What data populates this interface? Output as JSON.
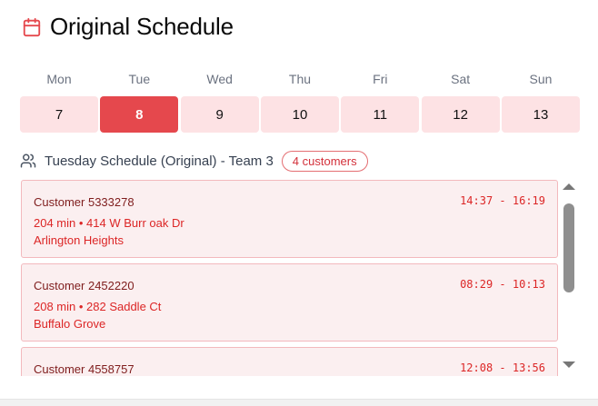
{
  "header": {
    "title": "Original Schedule",
    "icon": "calendar-icon"
  },
  "days": [
    {
      "name": "Mon",
      "num": "7"
    },
    {
      "name": "Tue",
      "num": "8",
      "active": true
    },
    {
      "name": "Wed",
      "num": "9"
    },
    {
      "name": "Thu",
      "num": "10"
    },
    {
      "name": "Fri",
      "num": "11"
    },
    {
      "name": "Sat",
      "num": "12"
    },
    {
      "name": "Sun",
      "num": "13"
    }
  ],
  "subheader": {
    "label": "Tuesday Schedule (Original) - Team 3",
    "badge": "4 customers",
    "icon": "users-icon"
  },
  "customers": [
    {
      "name": "Customer 5333278",
      "time": "14:37 - 16:19",
      "detail": "204 min • 414 W Burr oak Dr",
      "city": "Arlington Heights"
    },
    {
      "name": "Customer 2452220",
      "time": "08:29 - 10:13",
      "detail": "208 min • 282 Saddle Ct",
      "city": "Buffalo Grove"
    },
    {
      "name": "Customer 4558757",
      "time": "12:08 - 13:56",
      "detail": "",
      "city": ""
    }
  ],
  "colors": {
    "accent": "#e5484d",
    "day_bg": "#fde2e4",
    "item_bg": "#fbeff0",
    "item_border": "#f3b9bd",
    "text_red": "#dc2626"
  }
}
